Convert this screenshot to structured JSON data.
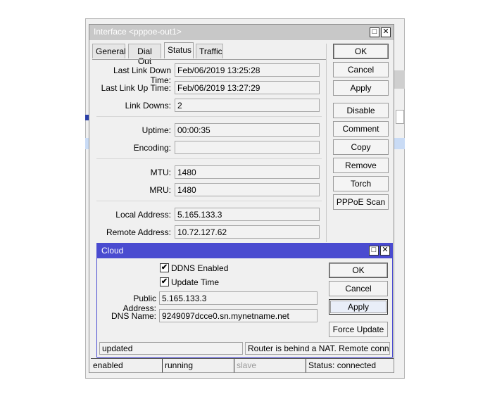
{
  "interface_window": {
    "title": "Interface <pppoe-out1>",
    "tabs": [
      "General",
      "Dial Out",
      "Status",
      "Traffic"
    ],
    "active_tab": "Status",
    "fields": {
      "last_link_down_time": {
        "label": "Last Link Down Time:",
        "value": "Feb/06/2019 13:25:28"
      },
      "last_link_up_time": {
        "label": "Last Link Up Time:",
        "value": "Feb/06/2019 13:27:29"
      },
      "link_downs": {
        "label": "Link Downs:",
        "value": "2"
      },
      "uptime": {
        "label": "Uptime:",
        "value": "00:00:35"
      },
      "encoding": {
        "label": "Encoding:",
        "value": ""
      },
      "mtu": {
        "label": "MTU:",
        "value": "1480"
      },
      "mru": {
        "label": "MRU:",
        "value": "1480"
      },
      "local_address": {
        "label": "Local Address:",
        "value": "5.165.133.3"
      },
      "remote_address": {
        "label": "Remote Address:",
        "value": "10.72.127.62"
      }
    },
    "buttons": {
      "ok": "OK",
      "cancel": "Cancel",
      "apply": "Apply",
      "disable": "Disable",
      "comment": "Comment",
      "copy": "Copy",
      "remove": "Remove",
      "torch": "Torch",
      "pppoe_scan": "PPPoE Scan"
    },
    "status_bar": {
      "enabled": "enabled",
      "running": "running",
      "slave": "slave",
      "status": "Status: connected"
    }
  },
  "cloud_window": {
    "title": "Cloud",
    "ddns_enabled": {
      "label": "DDNS Enabled",
      "checked": true
    },
    "update_time": {
      "label": "Update Time",
      "checked": true
    },
    "public_address": {
      "label": "Public Address:",
      "value": "5.165.133.3"
    },
    "dns_name": {
      "label": "DNS Name:",
      "value": "9249097dcce0.sn.mynetname.net"
    },
    "buttons": {
      "ok": "OK",
      "cancel": "Cancel",
      "apply": "Apply",
      "force_update": "Force Update"
    },
    "status_left": "updated",
    "status_right": "Router is behind a NAT. Remote connect..."
  },
  "window_controls": {
    "maximize": "□",
    "close": "✕",
    "check": "✔"
  }
}
